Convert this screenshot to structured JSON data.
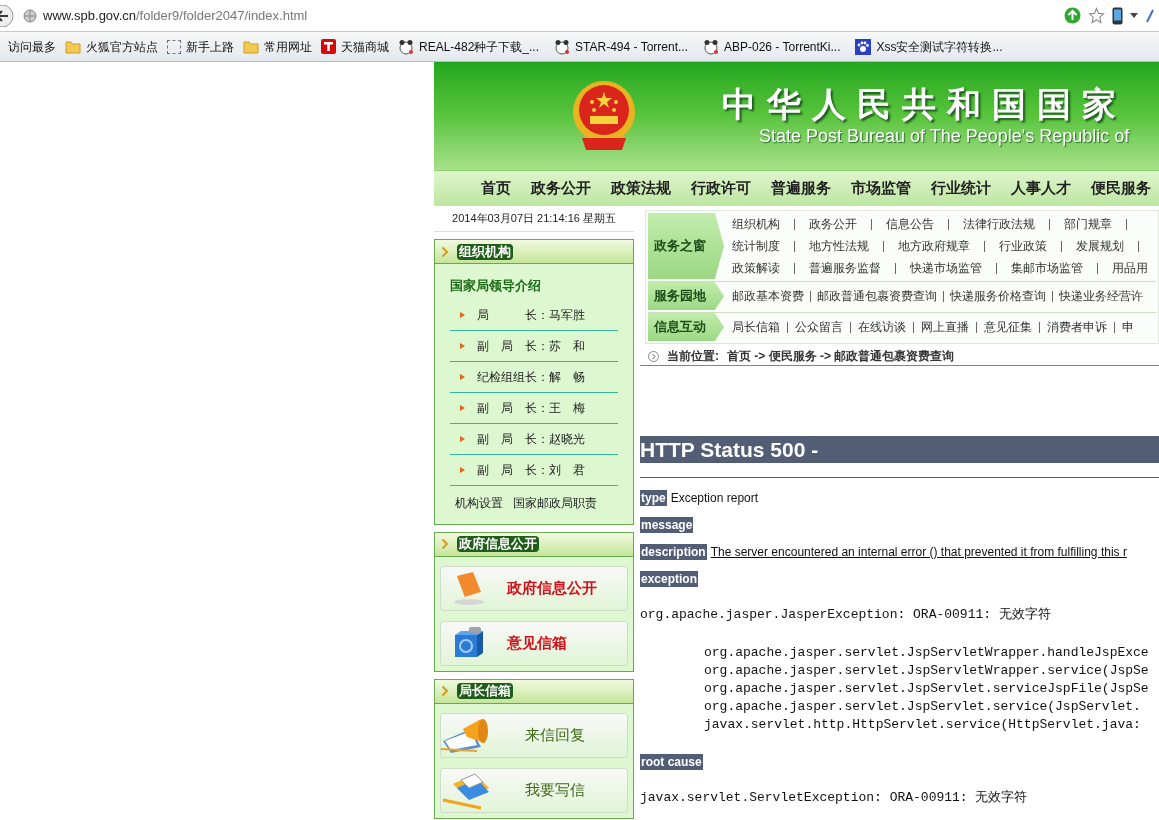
{
  "browser": {
    "url_domain": "www.spb.gov.cn",
    "url_path": "/folder9/folder2047/index.html",
    "bookmarks": [
      {
        "label": "访问最多",
        "kind": "none"
      },
      {
        "label": "火狐官方站点",
        "kind": "folder"
      },
      {
        "label": "新手上路",
        "kind": "blank"
      },
      {
        "label": "常用网址",
        "kind": "folder"
      },
      {
        "label": "天猫商城",
        "kind": "shop"
      },
      {
        "label": "REAL-482种子下载_...",
        "kind": "site"
      },
      {
        "label": "STAR-494 - Torrent...",
        "kind": "site"
      },
      {
        "label": "ABP-026 - TorrentKi...",
        "kind": "site"
      },
      {
        "label": "Xss安全测试字符转换...",
        "kind": "paw"
      }
    ]
  },
  "header": {
    "title": "中华人民共和国国家",
    "subtitle": "State Post Bureau of The People's Republic of"
  },
  "nav": [
    "首页",
    "政务公开",
    "政策法规",
    "行政许可",
    "普遍服务",
    "市场监管",
    "行业统计",
    "人事人才",
    "便民服务"
  ],
  "datetime": "2014年03月07日 21:14:16 星期五",
  "sidebar": [
    {
      "kind": "leaders",
      "title": "组织机构",
      "heading": "国家局领导介绍",
      "items": [
        "局　　　长：马军胜",
        "副　局　长：苏　和",
        "纪检组组长：解　畅",
        "副　局　长：王　梅",
        "副　局　长：赵晓光",
        "副　局　长：刘　君"
      ],
      "links": [
        "机构设置",
        "国家邮政局职责"
      ]
    },
    {
      "kind": "buttons",
      "title": "政府信息公开",
      "buttons": [
        {
          "label": "政府信息公开",
          "kind": "highlight"
        },
        {
          "label": "意见信箱",
          "kind": "highlight"
        }
      ]
    },
    {
      "kind": "buttons",
      "title": "局长信箱",
      "buttons": [
        {
          "label": "来信回复",
          "kind": "plain"
        },
        {
          "label": "我要写信",
          "kind": "plain"
        }
      ]
    }
  ],
  "menu": [
    {
      "label": "政务之窗",
      "rows": [
        [
          "组织机构",
          "政务公开",
          "信息公告",
          "法律行政法规",
          "部门规章"
        ],
        [
          "统计制度",
          "地方性法规",
          "地方政府规章",
          "行业政策",
          "发展规划"
        ],
        [
          "政策解读",
          "普遍服务监督",
          "快递市场监管",
          "集邮市场监管",
          "用品用"
        ]
      ]
    },
    {
      "label": "服务园地",
      "rows": [
        [
          "邮政基本资费",
          "邮政普通包裹资费查询",
          "快递服务价格查询",
          "快递业务经营许"
        ]
      ]
    },
    {
      "label": "信息互动",
      "rows": [
        [
          "局长信箱",
          "公众留言",
          "在线访谈",
          "网上直播",
          "意见征集",
          "消费者申诉",
          "申"
        ]
      ]
    }
  ],
  "breadcrumb": {
    "label": "当前位置:",
    "path": "首页 -> 便民服务 -> 邮政普通包裹资费查询"
  },
  "error": {
    "title": "HTTP Status 500 -",
    "blocks": [
      {
        "kind": "field",
        "label": "type",
        "value": "Exception report",
        "underlined": false
      },
      {
        "kind": "field",
        "label": "message"
      },
      {
        "kind": "field",
        "label": "description",
        "value": "The server encountered an internal error () that prevented it from fulfilling this r",
        "underlined": true
      },
      {
        "kind": "field",
        "label": "exception"
      },
      {
        "kind": "code",
        "text": "org.apache.jasper.JasperException: ORA-00911: 无效字符"
      },
      {
        "kind": "stack",
        "lines": [
          "org.apache.jasper.servlet.JspServletWrapper.handleJspExce",
          "org.apache.jasper.servlet.JspServletWrapper.service(JspSe",
          "org.apache.jasper.servlet.JspServlet.serviceJspFile(JspSe",
          "org.apache.jasper.servlet.JspServlet.service(JspServlet.",
          "javax.servlet.http.HttpServlet.service(HttpServlet.java:"
        ]
      },
      {
        "kind": "field",
        "label": "root cause"
      },
      {
        "kind": "code",
        "text": "javax.servlet.ServletException: ORA-00911: 无效字符"
      }
    ]
  }
}
